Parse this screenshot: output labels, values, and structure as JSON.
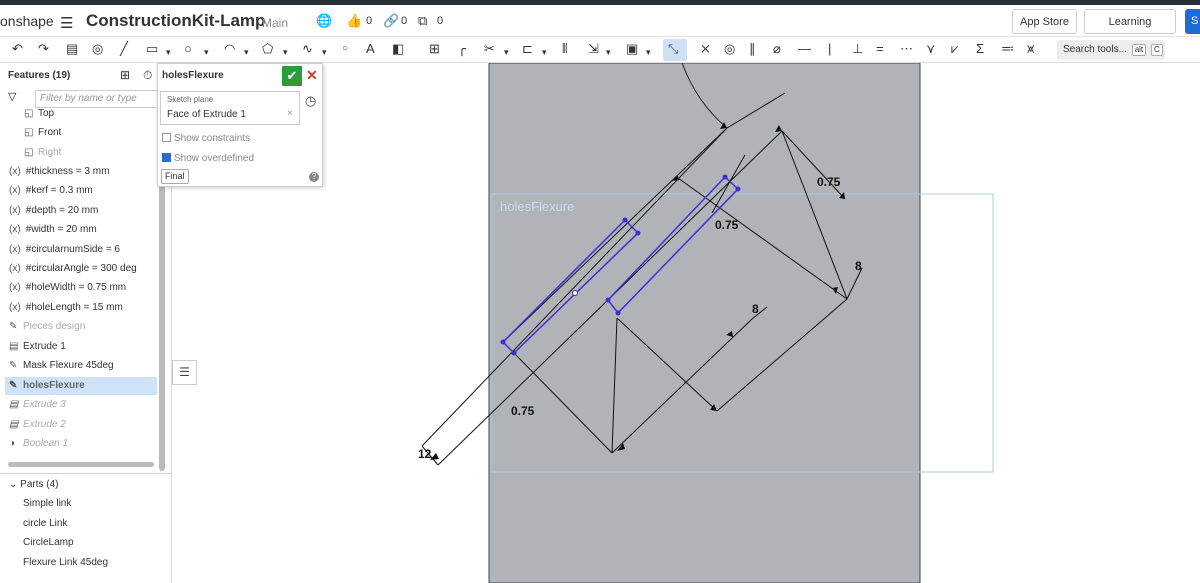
{
  "app": {
    "logo": "onshape",
    "doc_title": "ConstructionKit-Lamp",
    "workspace": "Main",
    "likes": "0",
    "links": "0",
    "copies": "0",
    "app_store": "App Store",
    "learning_center": "Learning Center",
    "blue_btn": "S"
  },
  "toolbar": {
    "search_label": "Search tools...",
    "shortcut_key1": "alt",
    "shortcut_key2": "C"
  },
  "features": {
    "title": "Features (19)",
    "filter_placeholder": "Filter by name or type",
    "items": [
      {
        "label": "Top",
        "icon": "plane-icon"
      },
      {
        "label": "Front",
        "icon": "plane-icon"
      },
      {
        "label": "Right",
        "icon": "plane-icon"
      },
      {
        "label": "#thickness = 3 mm",
        "icon": "variable-icon"
      },
      {
        "label": "#kerf = 0.3 mm",
        "icon": "variable-icon"
      },
      {
        "label": "#depth = 20 mm",
        "icon": "variable-icon"
      },
      {
        "label": "#width = 20 mm",
        "icon": "variable-icon"
      },
      {
        "label": "#circularnumSide = 6",
        "icon": "variable-icon"
      },
      {
        "label": "#circularAngle = 300 deg",
        "icon": "variable-icon"
      },
      {
        "label": "#holeWidth = 0.75 mm",
        "icon": "variable-icon"
      },
      {
        "label": "#holeLength = 15 mm",
        "icon": "variable-icon"
      },
      {
        "label": "Pieces design",
        "icon": "sketch-icon"
      },
      {
        "label": "Extrude 1",
        "icon": "extrude-icon"
      },
      {
        "label": "Mask Flexure 45deg",
        "icon": "sketch-icon"
      },
      {
        "label": "holesFlexure",
        "icon": "sketch-icon"
      },
      {
        "label": "Extrude 3",
        "icon": "extrude-icon"
      },
      {
        "label": "Extrude 2",
        "icon": "extrude-icon"
      },
      {
        "label": "Boolean 1",
        "icon": "boolean-icon"
      }
    ]
  },
  "parts": {
    "title": "Parts (4)",
    "items": [
      "Simple link",
      "circle Link",
      "CircleLamp",
      "Flexure Link 45deg"
    ]
  },
  "dialog": {
    "title": "holesFlexure",
    "field_label": "Sketch plane",
    "field_value": "Face of Extrude 1",
    "show_constraints": "Show constraints",
    "show_overdefined": "Show overdefined",
    "final_label": "Final",
    "show_constraints_checked": false,
    "show_overdefined_checked": true
  },
  "canvas": {
    "sketch_label": "holesFlexure",
    "dimensions": [
      "0.75",
      "0.75",
      "8",
      "8",
      "0.75",
      "12"
    ],
    "colors": {
      "part": "#b0b3b8",
      "sketch": "#3c2fd6",
      "dimension": "#111111"
    }
  }
}
